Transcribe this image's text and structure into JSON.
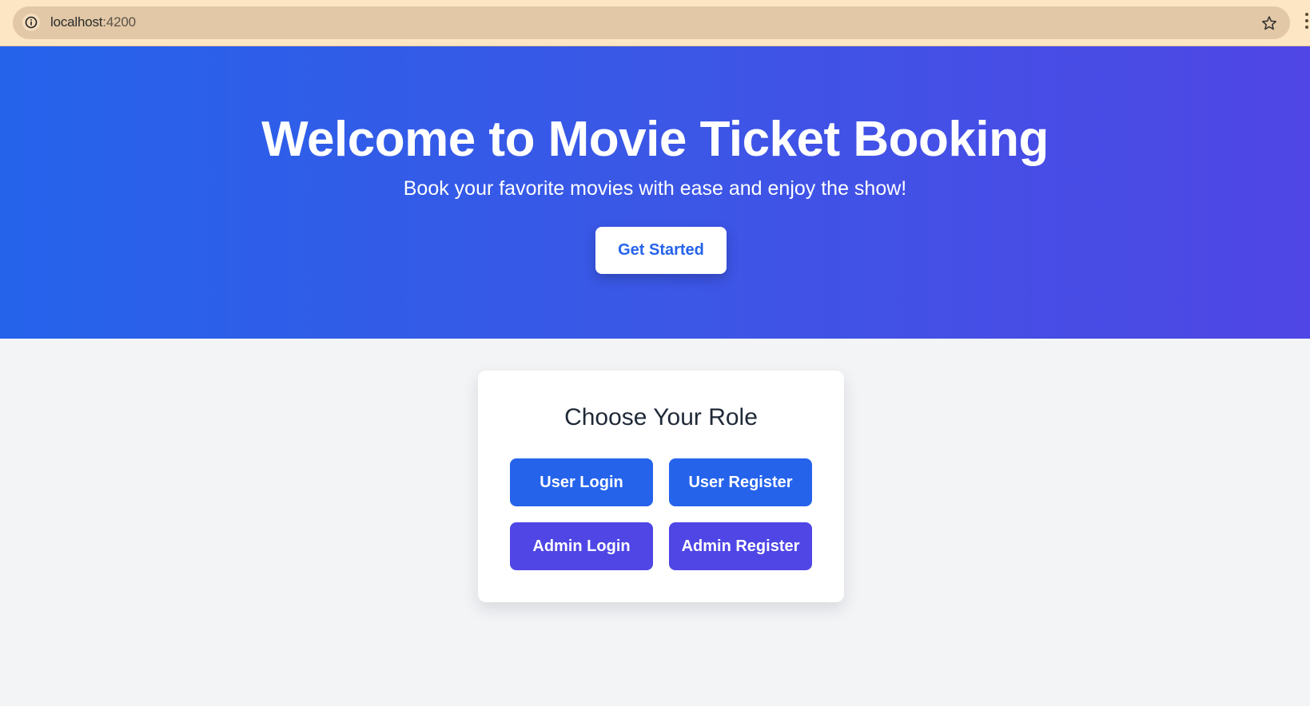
{
  "browser": {
    "url_host": "localhost",
    "url_port": ":4200",
    "icons": [
      "info-icon",
      "star-icon"
    ]
  },
  "hero": {
    "title": "Welcome to Movie Ticket Booking",
    "subtitle": "Book your favorite movies with ease and enjoy the show!",
    "cta_label": "Get Started"
  },
  "role_card": {
    "title": "Choose Your Role",
    "buttons": [
      {
        "label": "User Login"
      },
      {
        "label": "User Register"
      },
      {
        "label": "Admin Login"
      },
      {
        "label": "Admin Register"
      }
    ]
  },
  "colors": {
    "primary_blue": "#2563eb",
    "primary_indigo": "#4f46e5",
    "page_background": "#f3f4f6",
    "browser_bar": "#fde6c4"
  }
}
